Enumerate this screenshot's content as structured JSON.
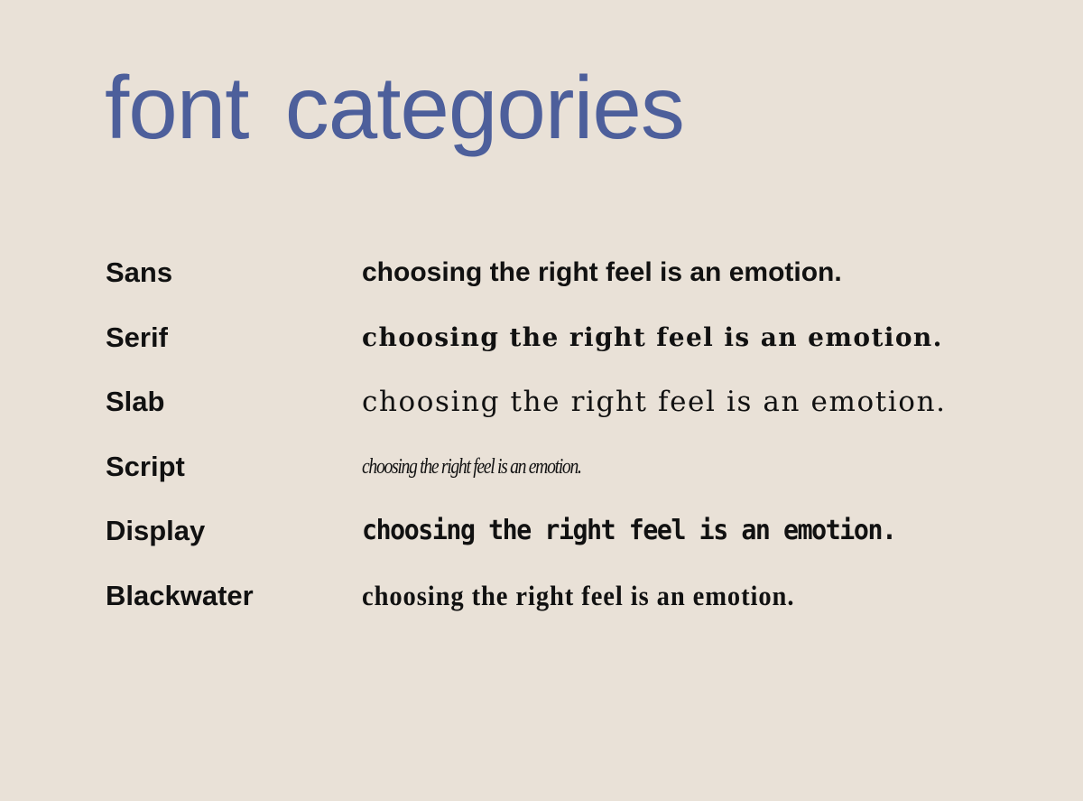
{
  "title": "font categories",
  "colors": {
    "background": "#e9e1d7",
    "title": "#4d5f9b",
    "text": "#111111"
  },
  "categories": [
    {
      "label": "Sans",
      "sample": "choosing the right feel is an emotion."
    },
    {
      "label": "Serif",
      "sample": "choosing the right feel is an emotion."
    },
    {
      "label": "Slab",
      "sample": "choosing the right feel is an emotion."
    },
    {
      "label": "Script",
      "sample": "choosing the right feel is an emotion."
    },
    {
      "label": "Display",
      "sample": "choosing the right feel is an emotion."
    },
    {
      "label": "Blackwater",
      "sample": "choosing the right feel is an emotion."
    }
  ]
}
